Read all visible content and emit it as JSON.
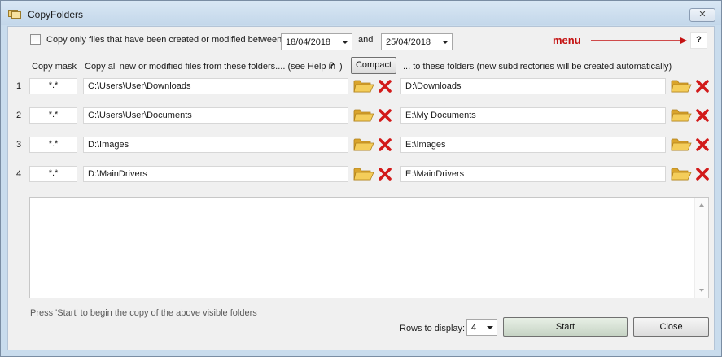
{
  "window": {
    "title": "CopyFolders",
    "close_label": "✕"
  },
  "date_filter": {
    "checkbox_label": "Copy only files that have been created or modified between",
    "checked": false,
    "from_date": "18/04/2018",
    "and_label": "and",
    "to_date": "25/04/2018"
  },
  "menu": {
    "label": "menu",
    "help_button": "?"
  },
  "headers": {
    "copy_mask": "Copy mask",
    "source": "Copy all new or modified files from these folders.... (see Help in",
    "source_help": "?",
    "source_close": ")",
    "compact_button": "Compact",
    "dest": "... to these folders (new subdirectories will be created automatically)"
  },
  "rows": [
    {
      "num": "1",
      "mask": "*.*",
      "source": "C:\\Users\\User\\Downloads",
      "dest": "D:\\Downloads"
    },
    {
      "num": "2",
      "mask": "*.*",
      "source": "C:\\Users\\User\\Documents",
      "dest": "E:\\My Documents"
    },
    {
      "num": "3",
      "mask": "*.*",
      "source": "D:\\Images",
      "dest": "E:\\Images"
    },
    {
      "num": "4",
      "mask": "*.*",
      "source": "D:\\MainDrivers",
      "dest": "E:\\MainDrivers"
    }
  ],
  "log": {
    "text": ""
  },
  "footer": {
    "hint": "Press 'Start' to begin the copy of the above visible folders",
    "rows_label": "Rows to display:",
    "rows_value": "4",
    "start_button": "Start",
    "close_button": "Close"
  },
  "colors": {
    "menu_accent": "#c41212",
    "folder": "#f1c24c",
    "delete": "#d21a1a",
    "window_frame": "#c9dced"
  },
  "icons": {
    "folder": "folder-open-icon",
    "delete": "delete-x-icon",
    "app": "copy-folders-app-icon"
  }
}
